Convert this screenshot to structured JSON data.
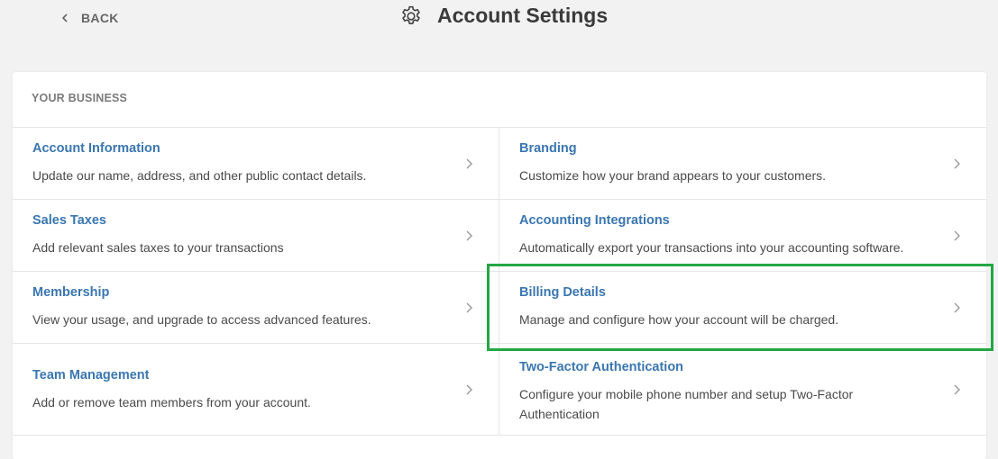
{
  "header": {
    "back_label": "BACK",
    "title": "Account Settings",
    "settings_icon": "gear-icon",
    "back_icon": "chevron-left-icon"
  },
  "section": {
    "label": "YOUR BUSINESS"
  },
  "items": [
    {
      "name": "Account Information",
      "desc": "Update our name, address, and other public contact details."
    },
    {
      "name": "Branding",
      "desc": "Customize how your brand appears to your customers."
    },
    {
      "name": "Sales Taxes",
      "desc": "Add relevant sales taxes to your transactions"
    },
    {
      "name": "Accounting Integrations",
      "desc": "Automatically export your transactions into your accounting software."
    },
    {
      "name": "Membership",
      "desc": "View your usage, and upgrade to access advanced features."
    },
    {
      "name": "Billing Details",
      "desc": "Manage and configure how your account will be charged."
    },
    {
      "name": "Team Management",
      "desc": "Add or remove team members from your account."
    },
    {
      "name": "Two-Factor Authentication",
      "desc": "Configure your mobile phone number and setup Two-Factor Authentication"
    }
  ],
  "colors": {
    "link": "#3a76b0",
    "highlight": "#22a744",
    "background": "#f2f2f2"
  }
}
